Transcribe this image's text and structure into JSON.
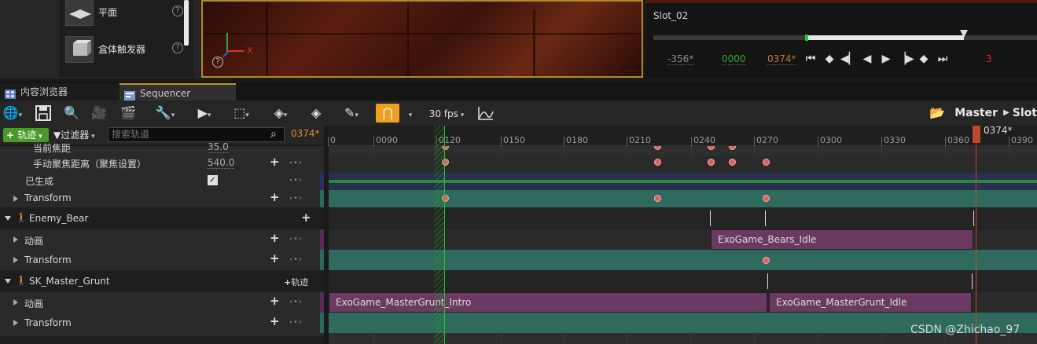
{
  "place_panel": {
    "items": [
      {
        "label": "平面",
        "icon": "plane-shape-icon"
      },
      {
        "label": "盒体触发器",
        "icon": "box-trigger-icon"
      }
    ]
  },
  "viewport": {
    "axis_label_x": "X"
  },
  "cinematic": {
    "slot_label": "Slot_02",
    "start_frame": "-356*",
    "current_frame": "0000",
    "end_frame": "0374*",
    "end_marker": "3",
    "colors": {
      "start": "#8a8a8a",
      "current": "#2eaa2e",
      "end": "#c07a3a"
    }
  },
  "tabs": [
    {
      "label": "内容浏览器",
      "icon": "content-browser-icon"
    },
    {
      "label": "Sequencer",
      "icon": "sequencer-icon"
    }
  ],
  "toolbar": {
    "fps": "30 fps",
    "breadcrumb_root": "Master",
    "breadcrumb_child": "Slot",
    "accent": "#f0a020"
  },
  "track_header": {
    "add_track": "轨迹",
    "filter": "过滤器",
    "search_placeholder": "搜索轨道",
    "frame_readout": "0374*"
  },
  "ruler": {
    "ticks": [
      "0",
      "0090",
      "0120",
      "0150",
      "0180",
      "0210",
      "0240",
      "0270",
      "0300",
      "0330",
      "0360",
      "0390"
    ],
    "playhead_label": "0374*"
  },
  "outliner": {
    "rows": [
      {
        "label": "当前焦距",
        "value": "35.0"
      },
      {
        "label": "手动聚焦距离（聚焦设置）",
        "value": "540.0"
      },
      {
        "label": "已生成"
      },
      {
        "label": "Transform"
      },
      {
        "label": "Enemy_Bear"
      },
      {
        "label": "动画"
      },
      {
        "label": "Transform"
      },
      {
        "label": "SK_Master_Grunt",
        "add_label": "轨迹"
      },
      {
        "label": "动画"
      },
      {
        "label": "Transform"
      }
    ]
  },
  "sections": {
    "bears_idle": "ExoGame_Bears_Idle",
    "grunt_intro": "ExoGame_MasterGrunt_Intro",
    "grunt_idle": "ExoGame_MasterGrunt_Idle"
  },
  "watermark": "CSDN @Zhichao_97"
}
